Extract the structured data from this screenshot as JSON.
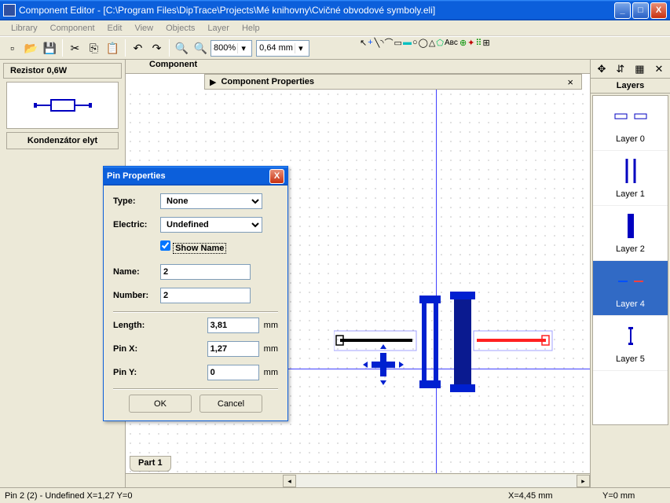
{
  "title": "Component Editor - [C:\\Program Files\\DipTrace\\Projects\\Mé knihovny\\Cvičné obvodové symboly.eli]",
  "menu": {
    "library": "Library",
    "component": "Component",
    "edit": "Edit",
    "view": "View",
    "objects": "Objects",
    "layer": "Layer",
    "help": "Help"
  },
  "toolbar": {
    "zoom": "800%",
    "grid": "0,64 mm"
  },
  "left": {
    "tab": "Rezistor 0,6W",
    "label": "Kondenzátor elyt"
  },
  "canvas": {
    "header": "Component",
    "props": "Component Properties",
    "part": "Part 1"
  },
  "layersPanel": {
    "title": "Layers",
    "items": [
      "Layer 0",
      "Layer 1",
      "Layer 2",
      "Layer 4",
      "Layer 5"
    ]
  },
  "dialog": {
    "title": "Pin Properties",
    "typeLabel": "Type:",
    "typeValue": "None",
    "electricLabel": "Electric:",
    "electricValue": "Undefined",
    "showName": "Show Name",
    "nameLabel": "Name:",
    "nameValue": "2",
    "numberLabel": "Number:",
    "numberValue": "2",
    "lengthLabel": "Length:",
    "lengthValue": "3,81",
    "pinxLabel": "Pin X:",
    "pinxValue": "1,27",
    "pinyLabel": "Pin Y:",
    "pinyValue": "0",
    "mm": "mm",
    "ok": "OK",
    "cancel": "Cancel"
  },
  "status": {
    "left": "Pin 2 (2) - Undefined   X=1,27 Y=0",
    "x": "X=4,45 mm",
    "y": "Y=0 mm"
  }
}
